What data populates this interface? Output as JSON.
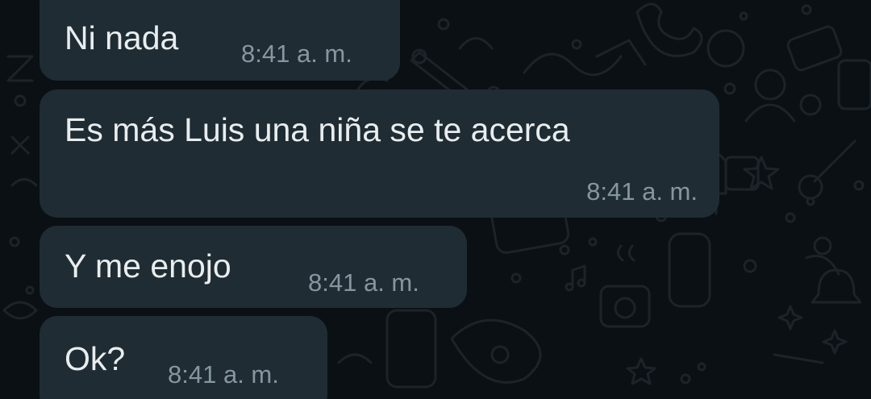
{
  "chat": {
    "wallpaper": "whatsapp-doodle-pattern",
    "colors": {
      "background": "#0b1014",
      "bubble": "#1f2c33",
      "text": "#e9edef",
      "timestamp": "#8696a0",
      "doodle": "#1c2329"
    },
    "messages": [
      {
        "text": "Ni nada",
        "time": "8:41 a. m."
      },
      {
        "text": "Es más Luis una niña se te acerca",
        "time": "8:41 a. m."
      },
      {
        "text": "Y me enojo",
        "time": "8:41 a. m."
      },
      {
        "text": "Ok?",
        "time": "8:41 a. m."
      }
    ]
  }
}
